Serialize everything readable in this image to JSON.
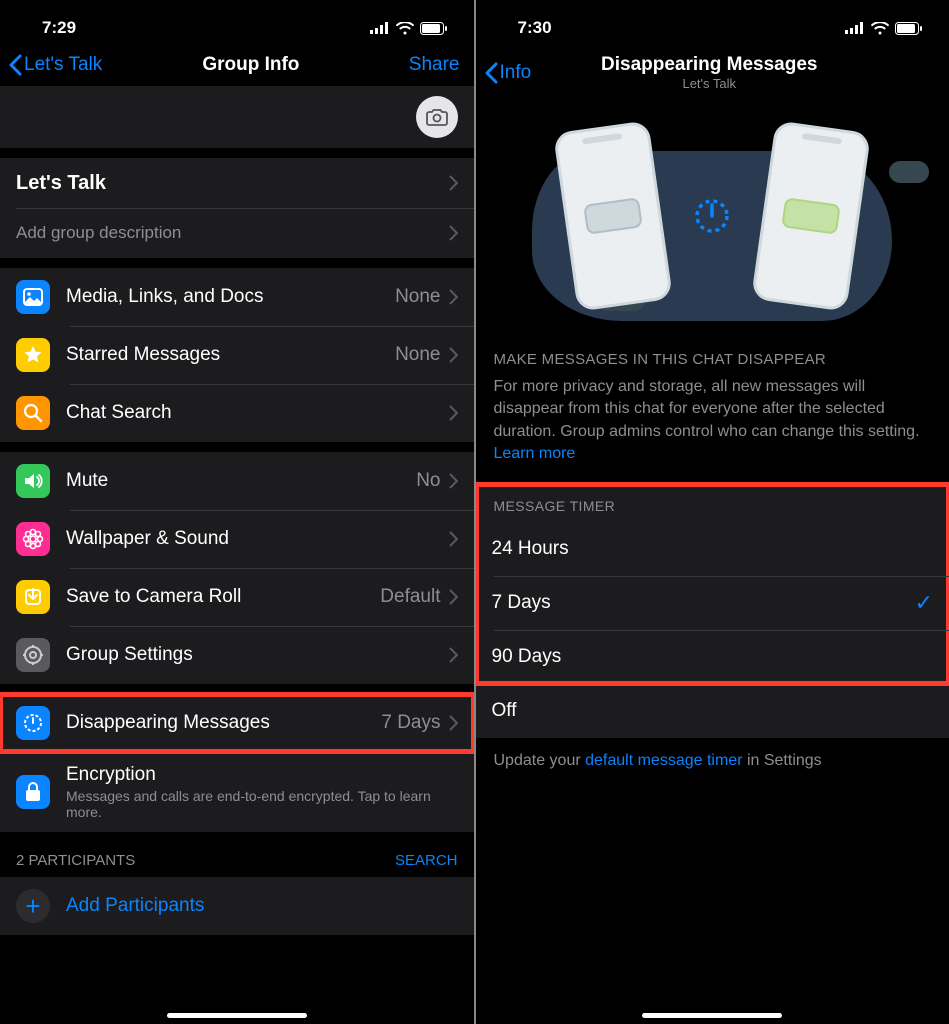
{
  "left": {
    "status": {
      "time": "7:29"
    },
    "nav": {
      "back": "Let's Talk",
      "title": "Group Info",
      "right": "Share"
    },
    "group": {
      "name": "Let's Talk",
      "description_placeholder": "Add group description"
    },
    "media": {
      "media_label": "Media, Links, and Docs",
      "media_value": "None",
      "starred_label": "Starred Messages",
      "starred_value": "None",
      "search_label": "Chat Search"
    },
    "settings": {
      "mute_label": "Mute",
      "mute_value": "No",
      "wallpaper_label": "Wallpaper & Sound",
      "save_label": "Save to Camera Roll",
      "save_value": "Default",
      "group_settings_label": "Group Settings"
    },
    "disappearing": {
      "label": "Disappearing Messages",
      "value": "7 Days"
    },
    "encryption": {
      "title": "Encryption",
      "subtitle": "Messages and calls are end-to-end encrypted. Tap to learn more."
    },
    "participants": {
      "header": "2 PARTICIPANTS",
      "search": "SEARCH",
      "add": "Add Participants"
    }
  },
  "right": {
    "status": {
      "time": "7:30"
    },
    "nav": {
      "back": "Info",
      "title": "Disappearing Messages",
      "subtitle": "Let's Talk"
    },
    "info_header": "MAKE MESSAGES IN THIS CHAT DISAPPEAR",
    "info_text": "For more privacy and storage, all new messages will disappear from this chat for everyone after the selected duration. Group admins control who can change this setting. ",
    "info_link": "Learn more",
    "timer_header": "MESSAGE TIMER",
    "options": {
      "o1": "24 Hours",
      "o2": "7 Days",
      "o3": "90 Days",
      "off": "Off"
    },
    "footer_pre": "Update your ",
    "footer_link": "default message timer",
    "footer_post": " in Settings"
  }
}
